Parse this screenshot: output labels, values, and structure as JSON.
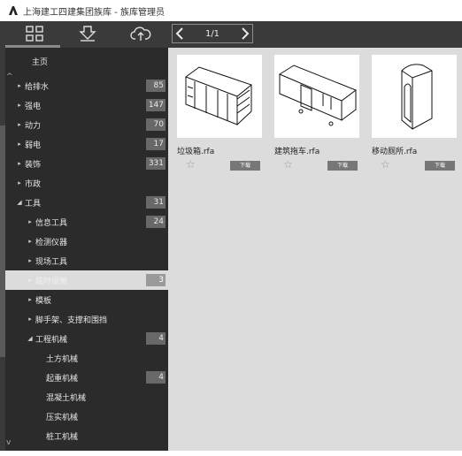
{
  "window": {
    "title": "上海建工四建集团族库 - 族库管理员"
  },
  "toolbar": {
    "icons": [
      "grid-icon",
      "download-icon",
      "cloud-upload-icon"
    ],
    "pager": {
      "prev": "<",
      "page": "1/1",
      "next": ">"
    }
  },
  "sidebar": {
    "home_label": "主页",
    "items": [
      {
        "label": "给排水",
        "count": "85",
        "arrow": "▸",
        "indent": 0
      },
      {
        "label": "强电",
        "count": "147",
        "arrow": "▸",
        "indent": 0
      },
      {
        "label": "动力",
        "count": "70",
        "arrow": "▸",
        "indent": 0
      },
      {
        "label": "弱电",
        "count": "17",
        "arrow": "▸",
        "indent": 0
      },
      {
        "label": "装饰",
        "count": "331",
        "arrow": "▸",
        "indent": 0
      },
      {
        "label": "市政",
        "count": "",
        "arrow": "▸",
        "indent": 0
      },
      {
        "label": "工具",
        "count": "31",
        "arrow": "◢",
        "indent": 0
      },
      {
        "label": "信息工具",
        "count": "24",
        "arrow": "▸",
        "indent": 1
      },
      {
        "label": "检测仪器",
        "count": "",
        "arrow": "▸",
        "indent": 1
      },
      {
        "label": "现场工具",
        "count": "",
        "arrow": "▸",
        "indent": 1
      },
      {
        "label": "临时设施",
        "count": "3",
        "arrow": "▸",
        "indent": 1,
        "selected": true
      },
      {
        "label": "模板",
        "count": "",
        "arrow": "▸",
        "indent": 1
      },
      {
        "label": "脚手架、支撑和围挡",
        "count": "",
        "arrow": "▸",
        "indent": 1
      },
      {
        "label": "工程机械",
        "count": "4",
        "arrow": "◢",
        "indent": 1
      },
      {
        "label": "土方机械",
        "count": "",
        "arrow": "",
        "indent": 2
      },
      {
        "label": "起重机械",
        "count": "4",
        "arrow": "",
        "indent": 2
      },
      {
        "label": "混凝土机械",
        "count": "",
        "arrow": "",
        "indent": 2
      },
      {
        "label": "压实机械",
        "count": "",
        "arrow": "",
        "indent": 2
      },
      {
        "label": "桩工机械",
        "count": "",
        "arrow": "",
        "indent": 2
      }
    ]
  },
  "content": {
    "cards": [
      {
        "name": "垃圾箱.rfa",
        "download_label": "下载"
      },
      {
        "name": "建筑拖车.rfa",
        "download_label": "下载"
      },
      {
        "name": "移动厕所.rfa",
        "download_label": "下载"
      }
    ]
  }
}
